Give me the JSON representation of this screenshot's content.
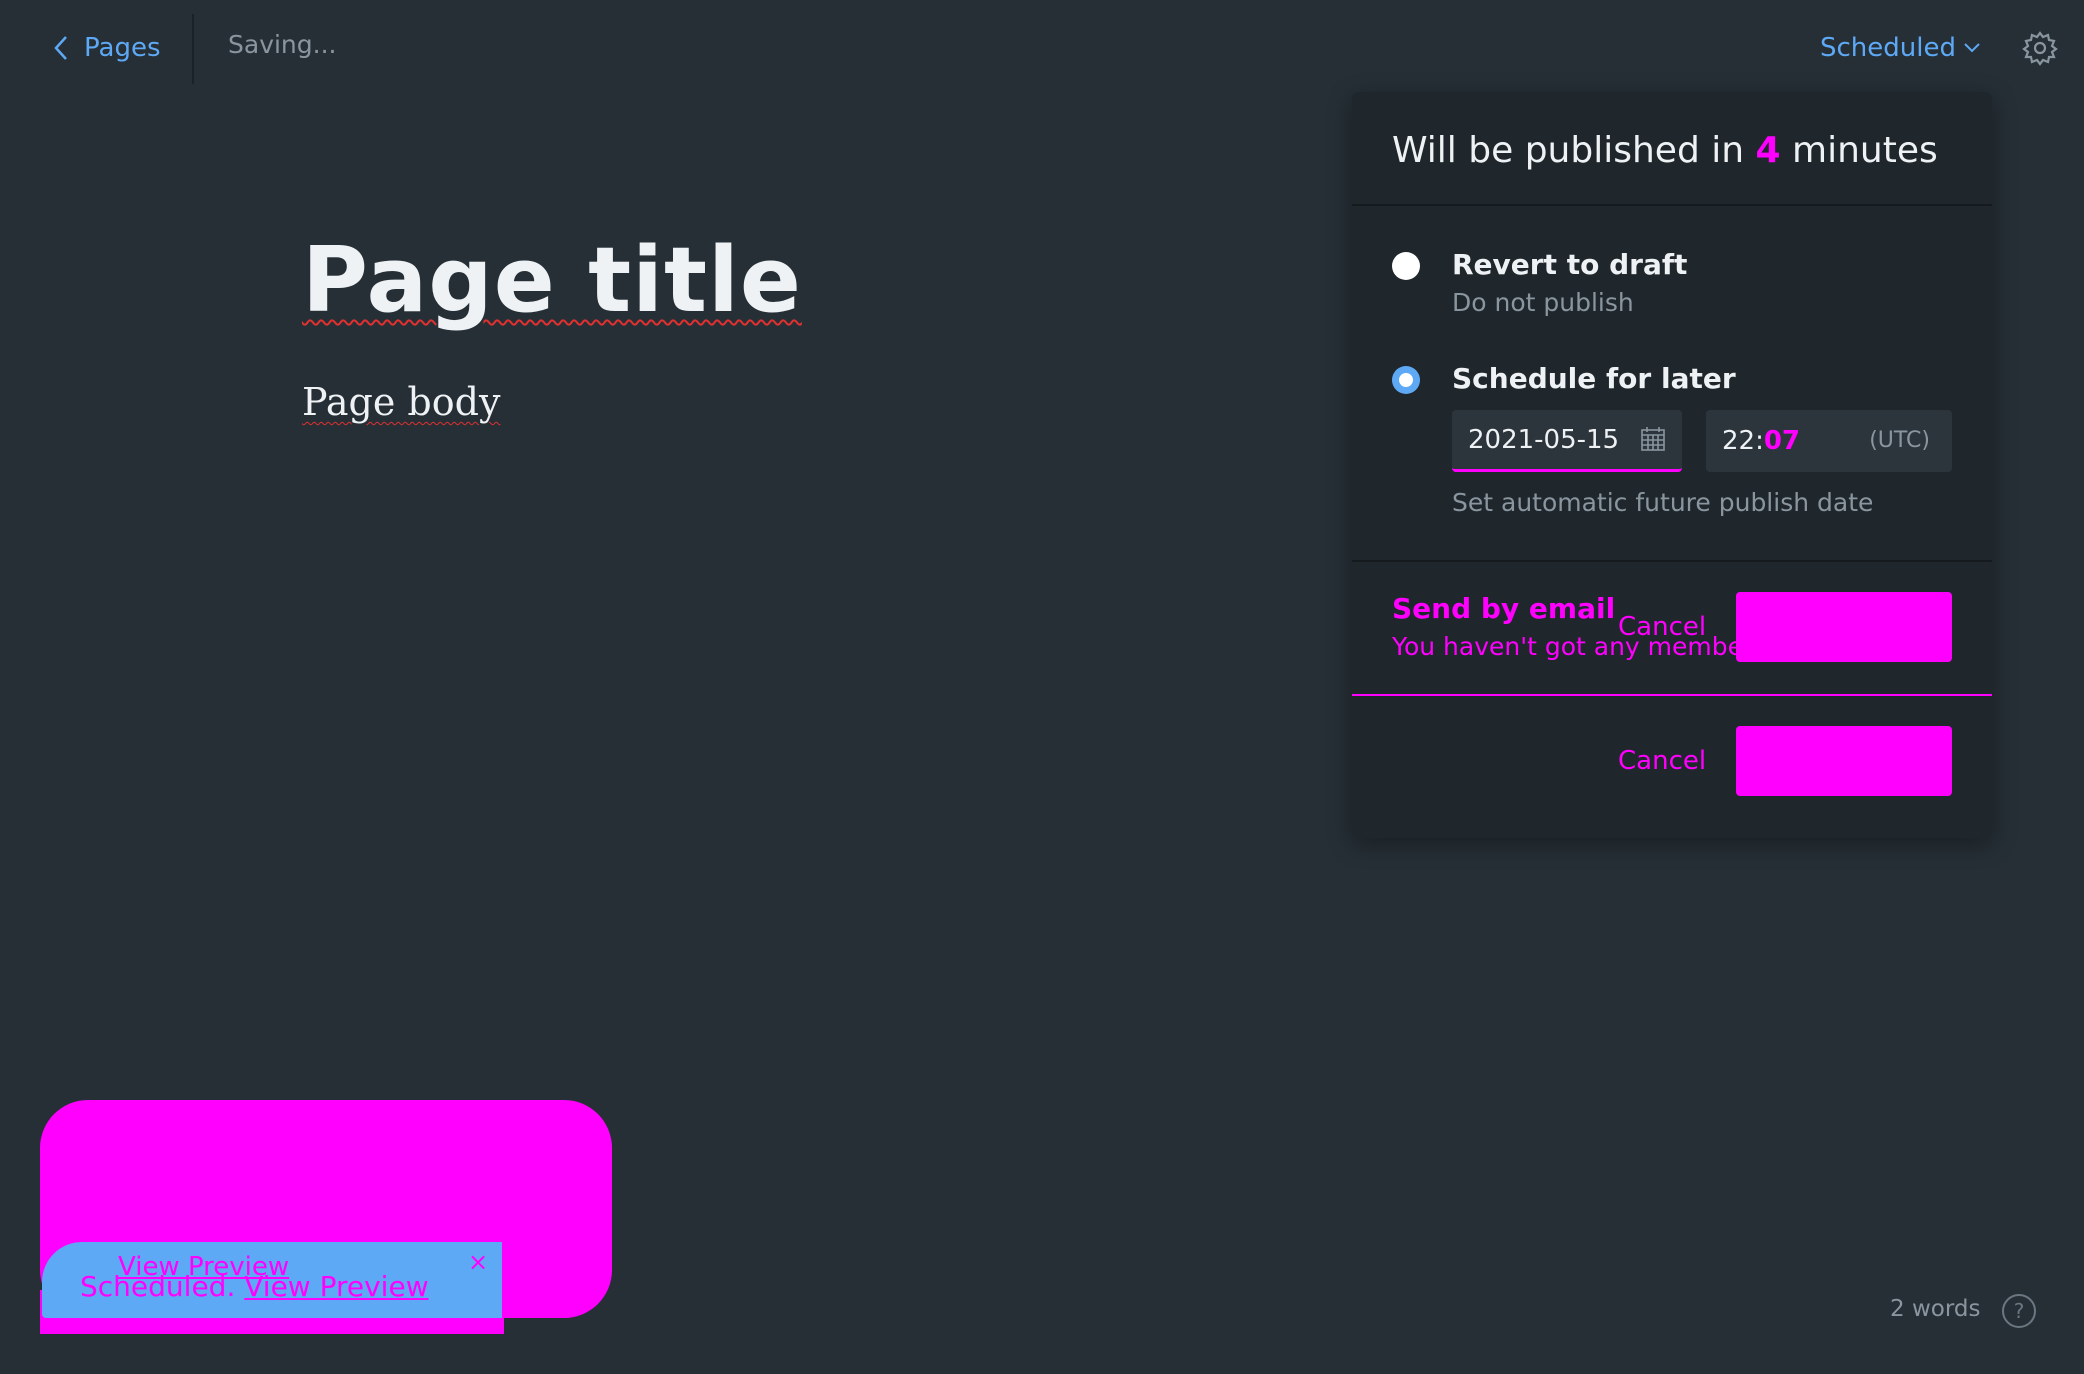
{
  "topbar": {
    "back_label": "Pages",
    "saving_text": "Saving...",
    "status_label": "Scheduled"
  },
  "editor": {
    "title": "Page title",
    "body": "Page body"
  },
  "publish_panel": {
    "heading_prefix": "Will be published in",
    "heading_minutes": "4",
    "heading_suffix": "minutes",
    "options": [
      {
        "label": "Revert to draft",
        "sub": "Do not publish",
        "checked": false
      },
      {
        "label": "Schedule for later",
        "checked": true
      }
    ],
    "date_value": "2021-05-15",
    "time_hour": "22:",
    "time_minute": "07",
    "timezone": "(UTC)",
    "hint": "Set automatic future publish date",
    "email_title": "Send by email",
    "email_sub": "You haven't got any members",
    "cancel_label": "Cancel"
  },
  "toast": {
    "preview_label": "View Preview",
    "message_prefix": "Scheduled.",
    "message_link": "View Preview",
    "close_glyph": "×"
  },
  "footer": {
    "word_count": "2 words",
    "help_glyph": "?"
  },
  "colors": {
    "background": "#262f36",
    "panel": "#1f272c",
    "accent_blue": "#5ea9f5",
    "magenta": "#ff00ff",
    "muted_text": "#8a969f"
  },
  "icons": {
    "back": "chevron-left-icon",
    "dropdown": "chevron-down-icon",
    "settings": "gear-icon",
    "calendar": "calendar-icon",
    "close": "close-icon",
    "help": "help-icon"
  }
}
